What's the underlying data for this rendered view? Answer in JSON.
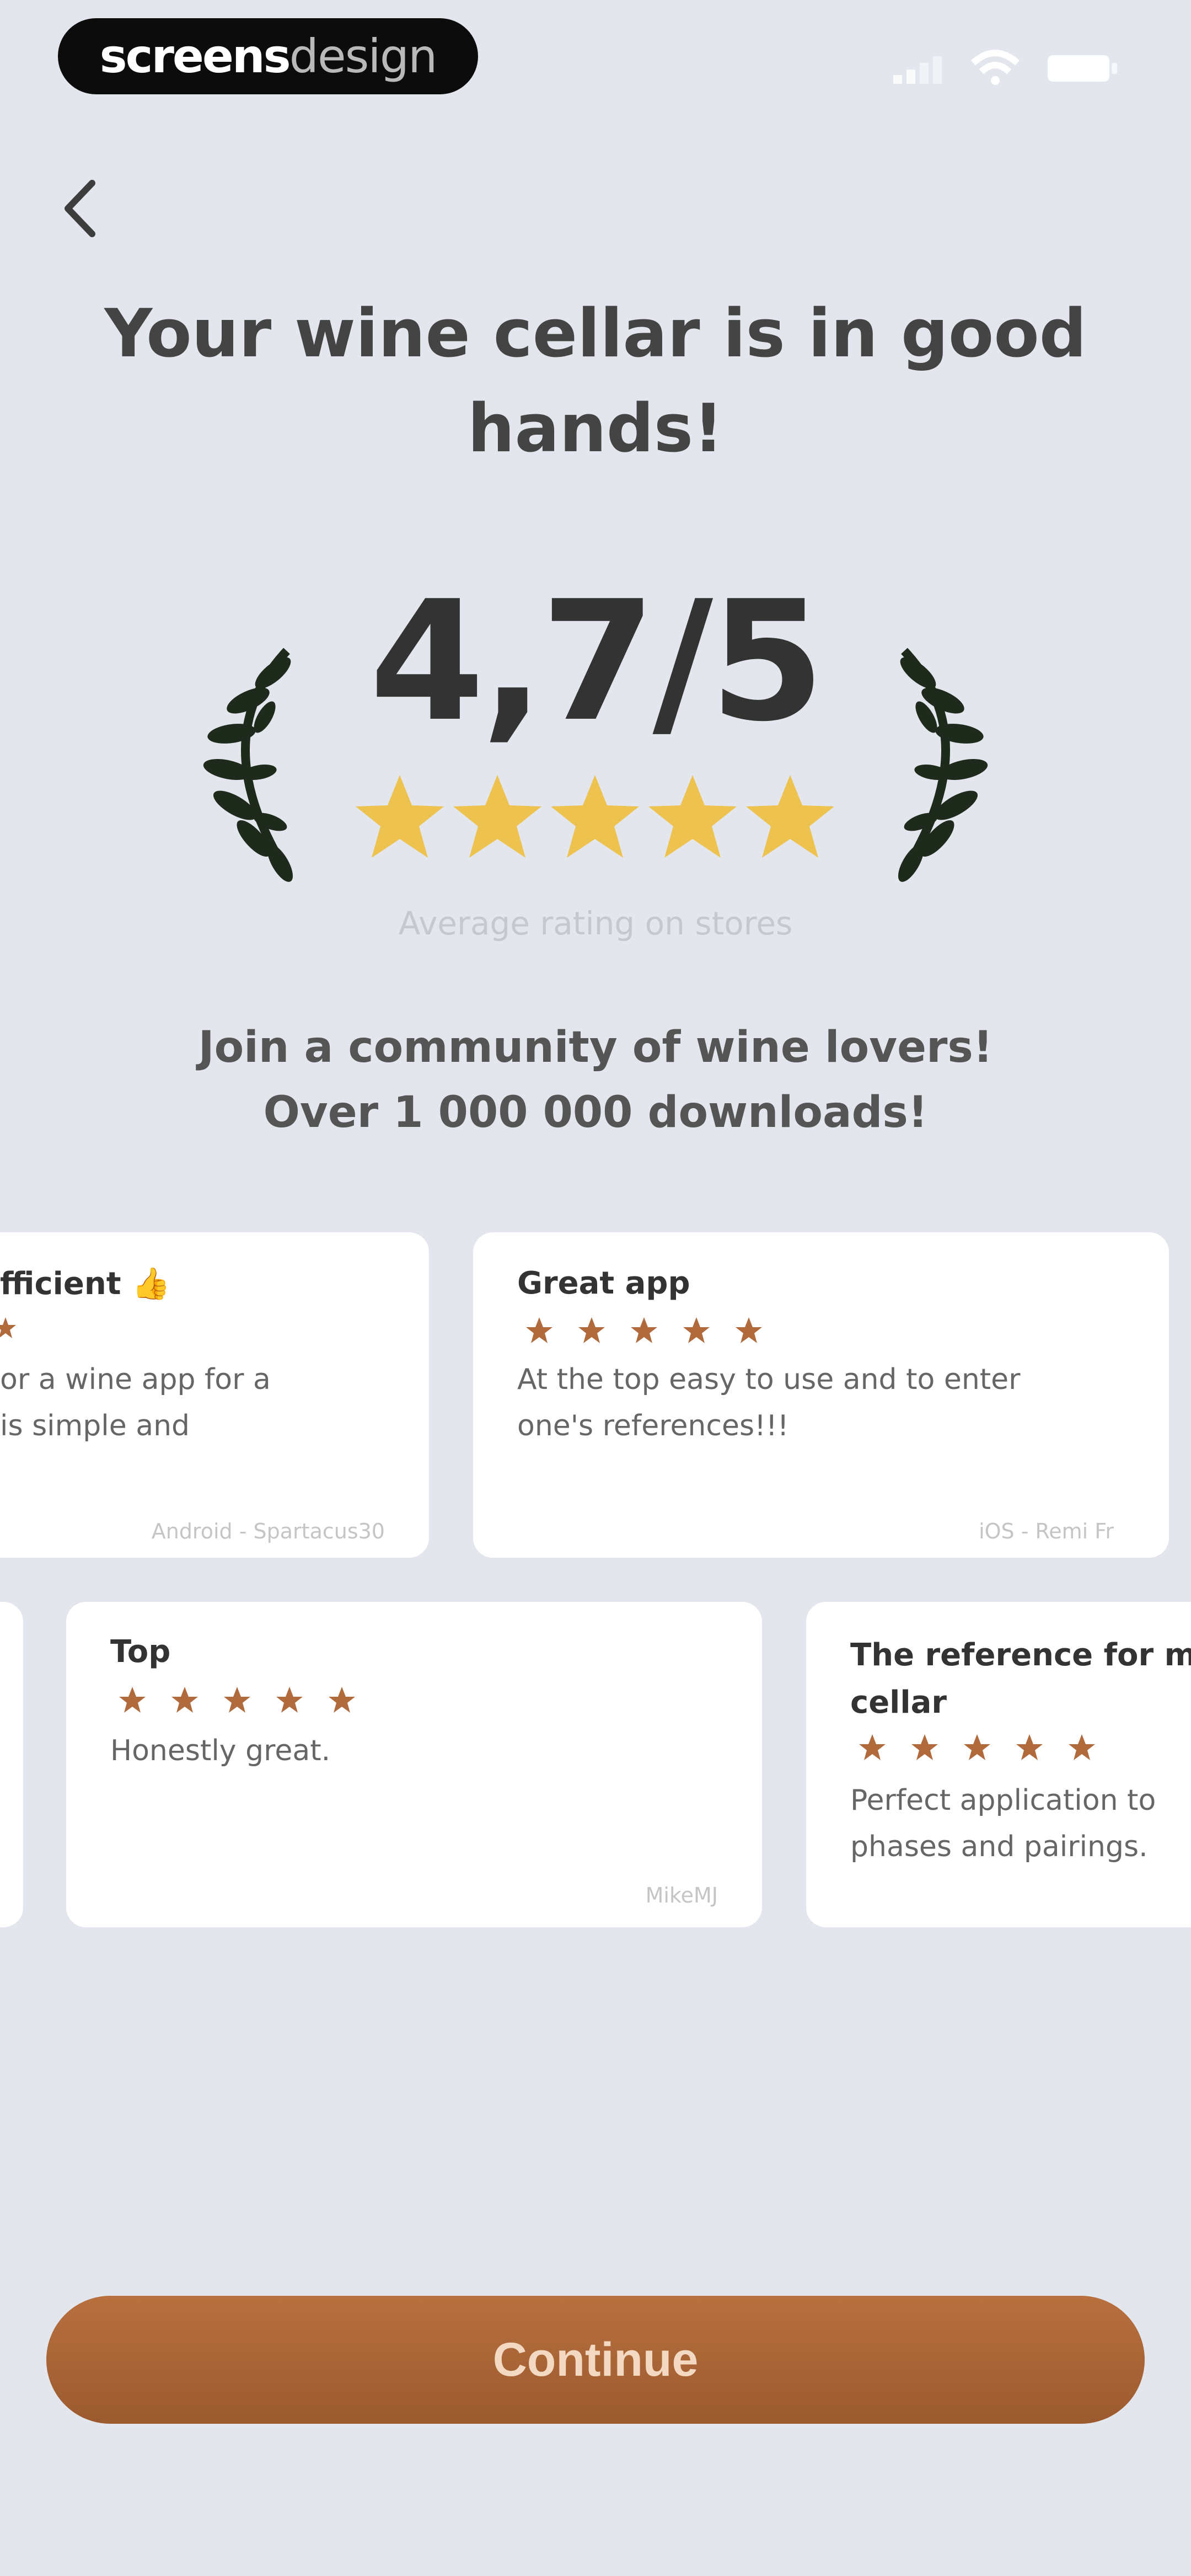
{
  "brand": {
    "part1": "screens",
    "part2": "design"
  },
  "header": {
    "title": "Your wine cellar is in good hands!"
  },
  "rating": {
    "score": "4,7/5",
    "stars": 5,
    "caption": "Average rating on stores",
    "star_color": "#eec24e"
  },
  "community": {
    "line1": "Join a community of wine lovers!",
    "line2": "Over 1 000 000 downloads!"
  },
  "reviews": [
    {
      "title": "fficient 👍",
      "text1": "or a wine app for a",
      "text2": "is simple and",
      "meta": "Android - Spartacus30"
    },
    {
      "title": "Great app",
      "text1": "At the top easy to use and to enter",
      "text2": "one's references!!!",
      "meta": "iOS - Remi Fr"
    },
    {
      "title": "Top",
      "text1": "Honestly great.",
      "text2": "",
      "meta": "MikeMJ"
    },
    {
      "title": "The reference for m",
      "title2": "cellar",
      "text1": "Perfect application to",
      "text2": "phases and pairings."
    }
  ],
  "review_star_color": "#b06a3c",
  "cta": {
    "label": "Continue"
  },
  "colors": {
    "background": "#e3e6ec",
    "accent": "#a8643a",
    "laurel": "#1e2a1c"
  }
}
